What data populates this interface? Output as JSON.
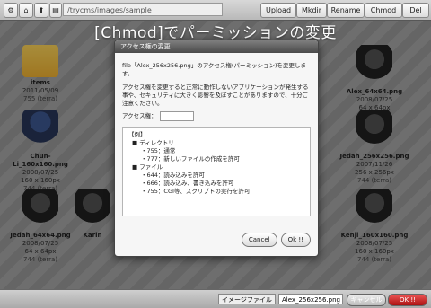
{
  "toolbar": {
    "path": "/trycms/images/sample",
    "buttons": [
      "Upload",
      "Mkdir",
      "Rename",
      "Chmod",
      "Del"
    ]
  },
  "headline": "[Chmod]でパーミッションの変更",
  "files": [
    {
      "name": "items",
      "date": "2011/05/09",
      "meta": "",
      "perm": "755 (terra)"
    },
    {
      "name": "Chun-Li_160x160.png",
      "date": "2008/07/25",
      "meta": "160 x 160px",
      "perm": "744 (terra)"
    },
    {
      "name": "Jedah_64x64.png",
      "date": "2008/07/25",
      "meta": "64 x 64px",
      "perm": "744 (terra)"
    },
    {
      "name": "Karin",
      "date": "",
      "meta": "",
      "perm": ""
    },
    {
      "name": "Alex_64x64.png",
      "date": "2008/07/25",
      "meta": "64 x 64px",
      "perm": "744 (terra)"
    },
    {
      "name": "Jedah_256x256.png",
      "date": "2007/11/26",
      "meta": "256 x 256px",
      "perm": "744 (terra)"
    },
    {
      "name": "Kenji_160x160.png",
      "date": "2008/07/25",
      "meta": "160 x 160px",
      "perm": "744 (terra)"
    }
  ],
  "dialog": {
    "title": "アクセス権の変更",
    "intro": "file「Alex_256x256.png」のアクセス権(パーミッション)を変更します。",
    "warning": "アクセス権を変更すると正常に動作しないアプリケーションが発生する事や、セキュリティに大きく影響を及ぼすことがありますので、十分ご注意ください。",
    "field_label": "アクセス権：",
    "field_value": "",
    "example_heading": "【例】",
    "example_lines": [
      "■ ディレクトリ",
      "・755：通常",
      "・777：新しいファイルの作成を許可",
      "■ ファイル",
      "・644：読み込みを許可",
      "・666：読み込み、書き込みを許可",
      "・755：CGI等、スクリプトの実行を許可"
    ],
    "cancel_label": "Cancel",
    "ok_label": "Ok !!"
  },
  "bottombar": {
    "filetype": "イメージファイル",
    "filename": "Alex_256x256.png",
    "cancel_label": "キャンセル",
    "ok_label": "OK !!"
  }
}
